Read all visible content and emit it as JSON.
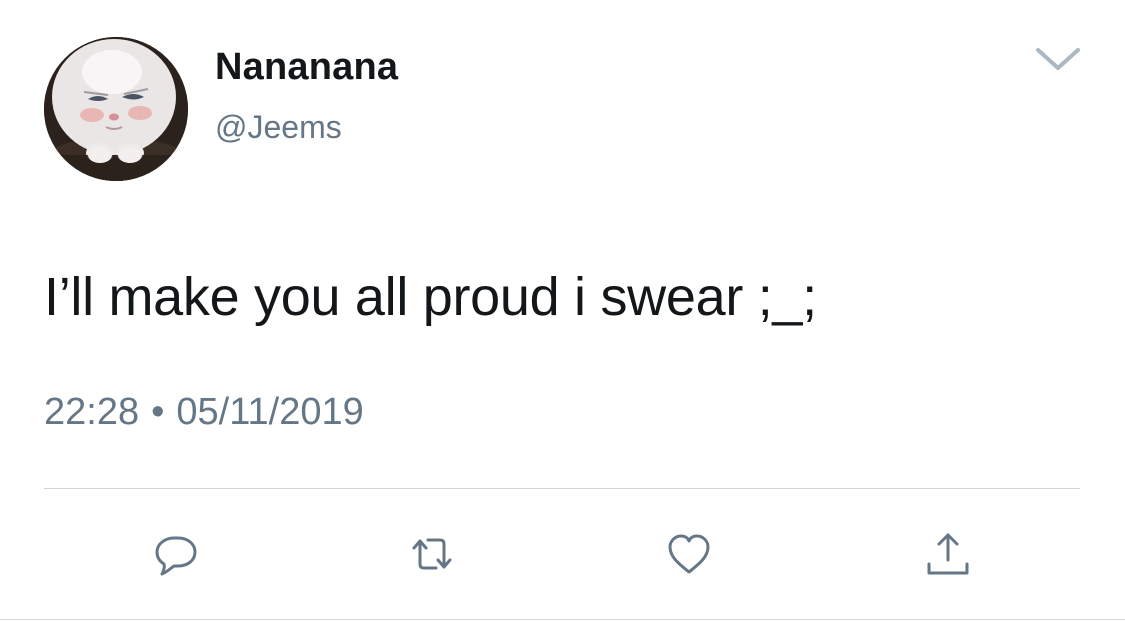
{
  "tweet": {
    "display_name": "Nananana",
    "handle": "@Jeems",
    "text": "I’ll make you all proud i swear ;_;",
    "time": "22:28",
    "separator": "•",
    "date": "05/11/2019"
  },
  "icons": {
    "avatar": "avatar-image",
    "more": "chevron-down-icon",
    "reply": "reply-icon",
    "retweet": "retweet-icon",
    "like": "heart-icon",
    "share": "share-icon"
  },
  "colors": {
    "text": "#14171a",
    "secondary": "#657786",
    "icon": "#657786",
    "divider": "#cfd5da"
  }
}
